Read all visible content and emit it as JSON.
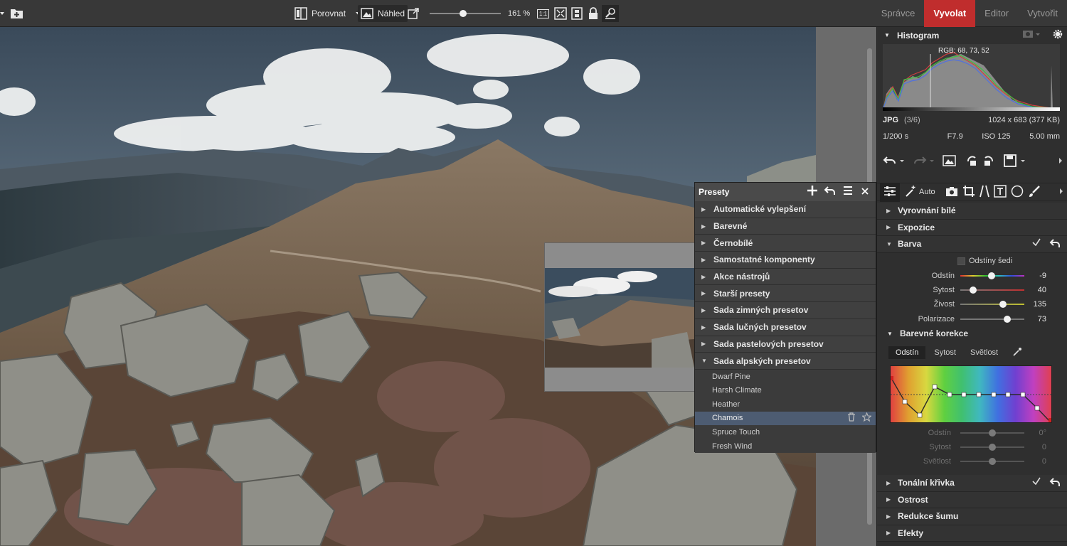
{
  "toolbar": {
    "compare_label": "Porovnat",
    "preview_label": "Náhled",
    "zoom_value": "161 %",
    "zoom_fraction": 0.47,
    "fit_1to1": "1:1"
  },
  "modes": [
    {
      "label": "Správce",
      "active": false
    },
    {
      "label": "Vyvolat",
      "active": true
    },
    {
      "label": "Editor",
      "active": false
    },
    {
      "label": "Vytvořit",
      "active": false
    }
  ],
  "presets": {
    "title": "Presety",
    "categories": [
      "Automatické vylepšení",
      "Barevné",
      "Černobílé",
      "Samostatné komponenty",
      "Akce nástrojů",
      "Starší presety",
      "Sada zimných presetov",
      "Sada lučných presetov",
      "Sada pastelových presetov",
      "Sada alpských presetov"
    ],
    "items": [
      "Dwarf Pine",
      "Harsh Climate",
      "Heather",
      "Chamois",
      "Spruce Touch",
      "Fresh Wind"
    ],
    "selected_item": "Chamois"
  },
  "histogram": {
    "title": "Histogram",
    "rgb_readout": "RGB: 68, 73, 52",
    "format": "JPG",
    "index": "(3/6)",
    "dimensions": "1024 x 683 (377 KB)",
    "shutter": "1/200 s",
    "aperture": "F7.9",
    "iso": "ISO 125",
    "focal": "5.00 mm"
  },
  "tools": {
    "auto_label": "Auto"
  },
  "sections": {
    "white_balance": "Vyrovnání bílé",
    "exposure": "Expozice",
    "color": "Barva",
    "tone_curve": "Tonální křivka",
    "sharpen": "Ostrost",
    "noise": "Redukce šumu",
    "effects": "Efekty"
  },
  "color": {
    "grayscale_label": "Odstíny šedi",
    "sliders": [
      {
        "label": "Odstín",
        "value": "-9",
        "pos": 0.49
      },
      {
        "label": "Sytost",
        "value": "40",
        "pos": 0.2
      },
      {
        "label": "Živost",
        "value": "135",
        "pos": 0.67
      },
      {
        "label": "Polarizace",
        "value": "73",
        "pos": 0.73
      }
    ],
    "corrections_title": "Barevné korekce",
    "tabs": [
      "Odstín",
      "Sytost",
      "Světlost"
    ],
    "active_tab": "Odstín",
    "dim_sliders": [
      {
        "label": "Odstín",
        "value": "0°"
      },
      {
        "label": "Sytost",
        "value": "0"
      },
      {
        "label": "Světlost",
        "value": "0"
      }
    ]
  },
  "colors": {
    "accent": "#c02d2d",
    "selection": "#4d5c72"
  }
}
